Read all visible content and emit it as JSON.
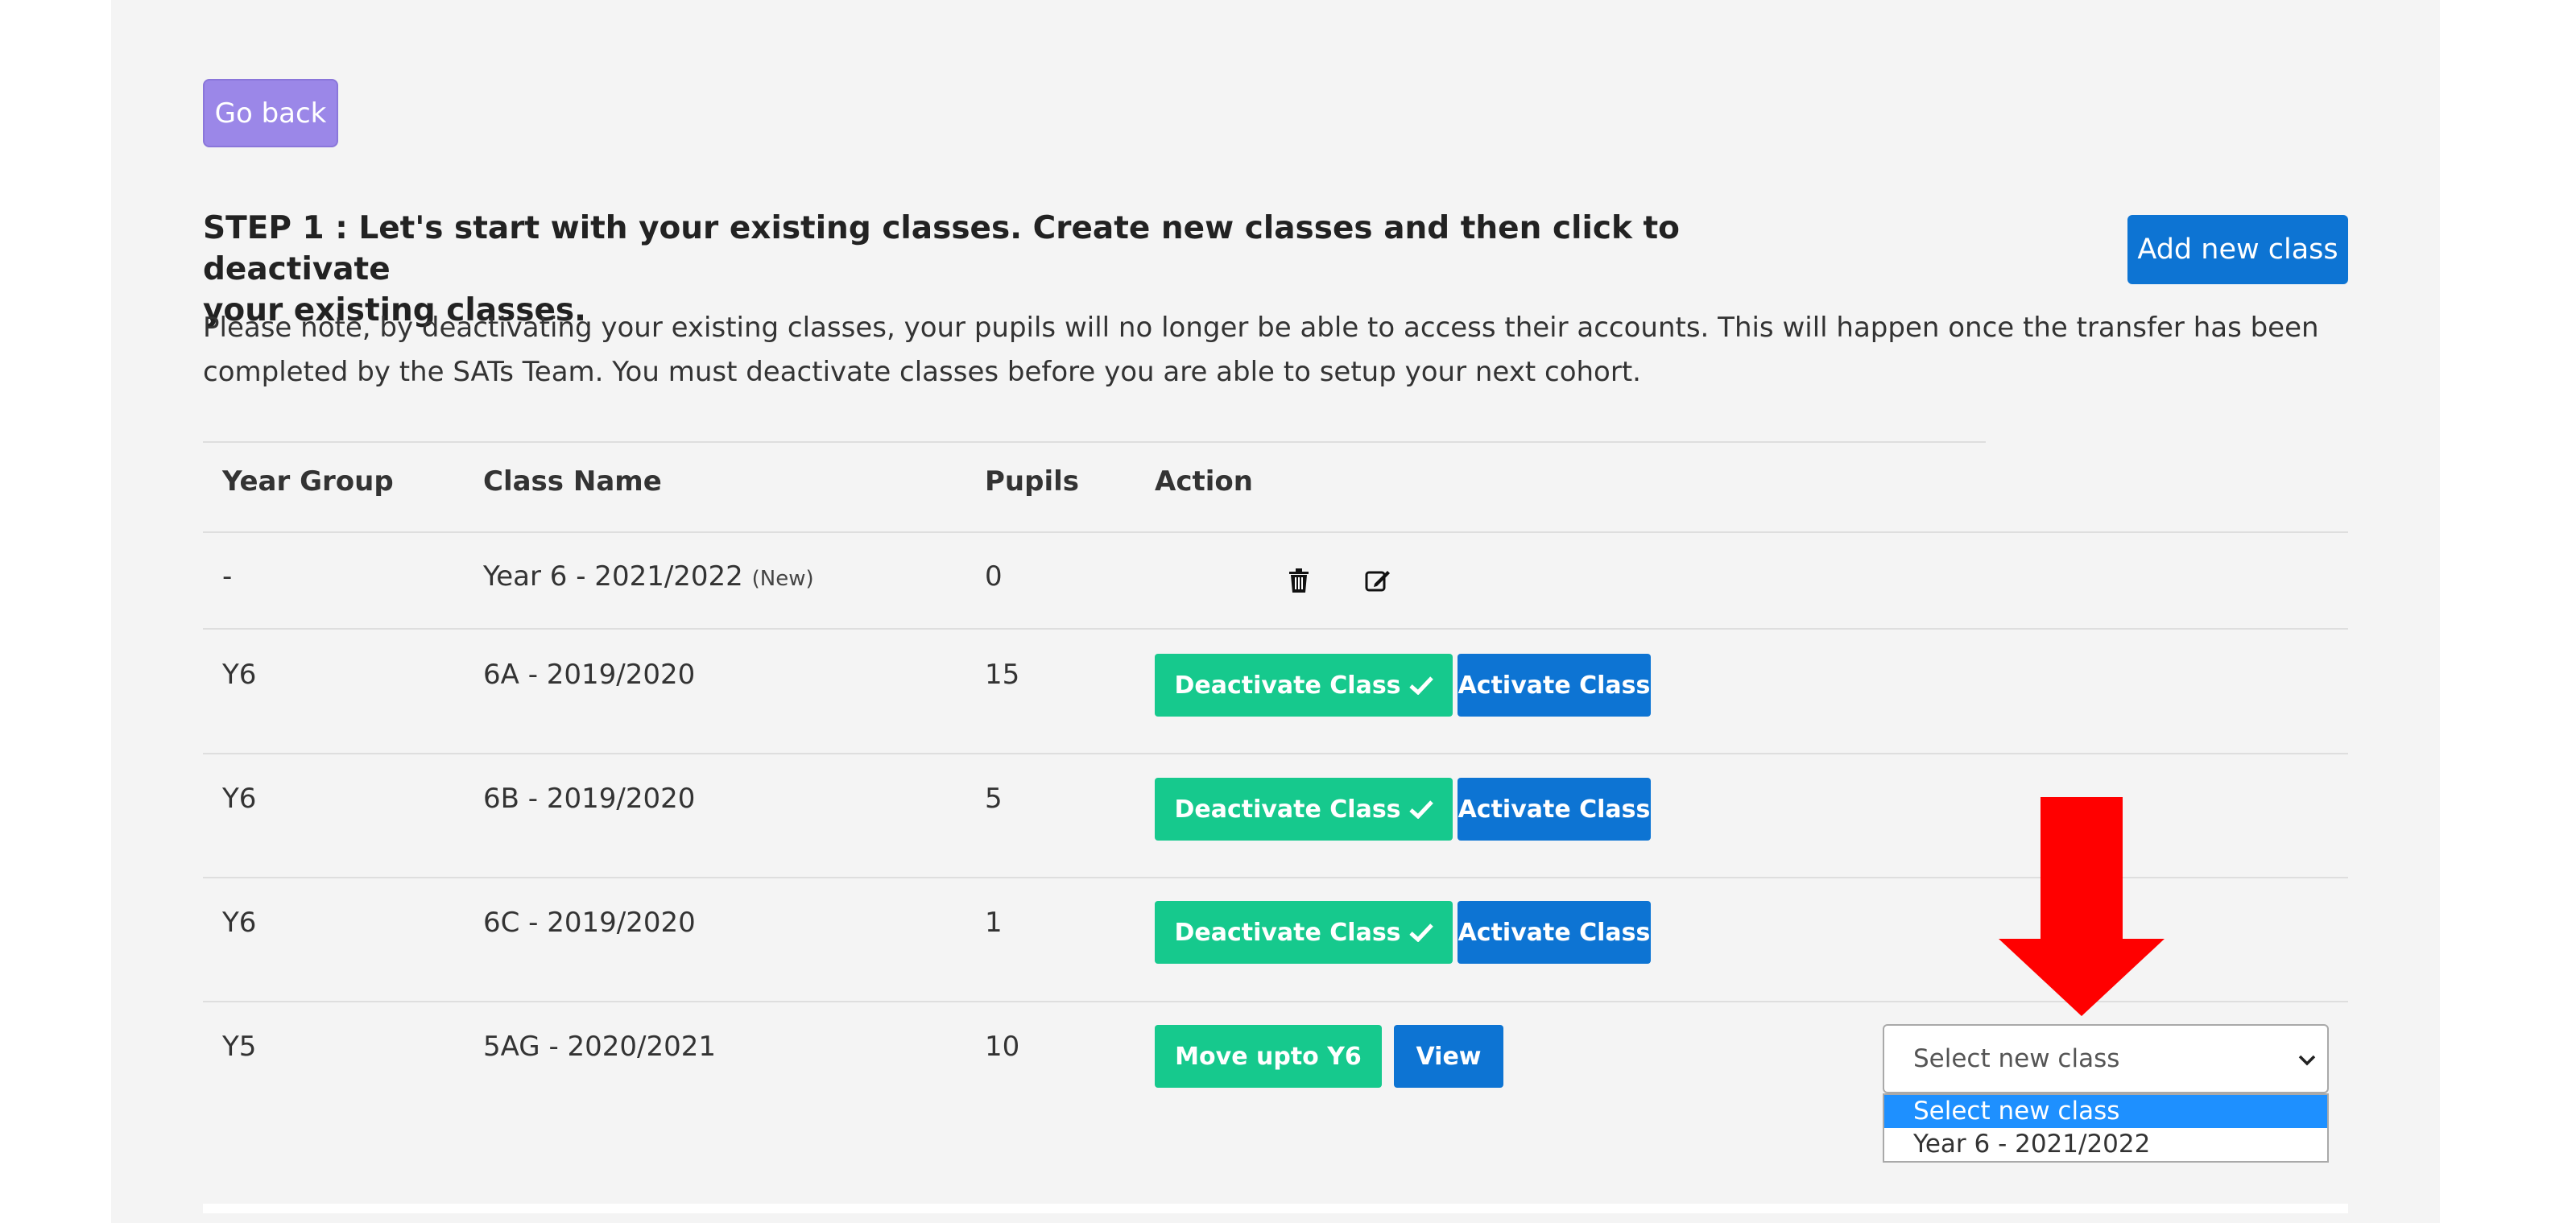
{
  "nav": {
    "go_back_label": "Go back"
  },
  "step": {
    "heading_line1": "STEP 1 : Let's start with your existing classes. Create new classes and then click to deactivate",
    "heading_line2": "your existing classes.",
    "add_button_label": "Add new class",
    "note_line1": "Please note, by deactivating your existing classes, your pupils will no longer be able to access their accounts. This will happen once the transfer has been",
    "note_line2": "completed by the SATs Team. You must deactivate classes before you are able to setup your next cohort."
  },
  "table": {
    "headers": [
      "Year Group",
      "Class Name",
      "Pupils",
      "Action"
    ],
    "rows": [
      {
        "year": "-",
        "class_name": "Year 6 - 2021/2022",
        "badge": "(New)",
        "pupils": "0"
      },
      {
        "year": "Y6",
        "class_name": "6A - 2019/2020",
        "pupils": "15",
        "primary_action": "Deactivate Class",
        "secondary_action": "Activate Class"
      },
      {
        "year": "Y6",
        "class_name": "6B - 2019/2020",
        "pupils": "5",
        "primary_action": "Deactivate Class",
        "secondary_action": "Activate Class"
      },
      {
        "year": "Y6",
        "class_name": "6C - 2019/2020",
        "pupils": "1",
        "primary_action": "Deactivate Class",
        "secondary_action": "Activate Class"
      },
      {
        "year": "Y5",
        "class_name": "5AG - 2020/2021",
        "pupils": "10",
        "primary_action": "Move upto Y6",
        "secondary_action": "View"
      }
    ]
  },
  "class_select": {
    "selected": "Select new class",
    "options": [
      "Select new class",
      "Year 6 - 2021/2022"
    ]
  },
  "icons": {
    "delete": "trash-icon",
    "edit": "edit-icon",
    "check": "check-icon",
    "dropdown": "chevron-down-icon",
    "annotation": "down-arrow-annotation"
  },
  "colors": {
    "panel_bg": "#f4f4f4",
    "go_back": "#9b87e8",
    "primary_blue": "#0d74d3",
    "deactivate_green": "#16c98d",
    "annotation_red": "#ff0000",
    "selected_option": "#1e90ff"
  }
}
